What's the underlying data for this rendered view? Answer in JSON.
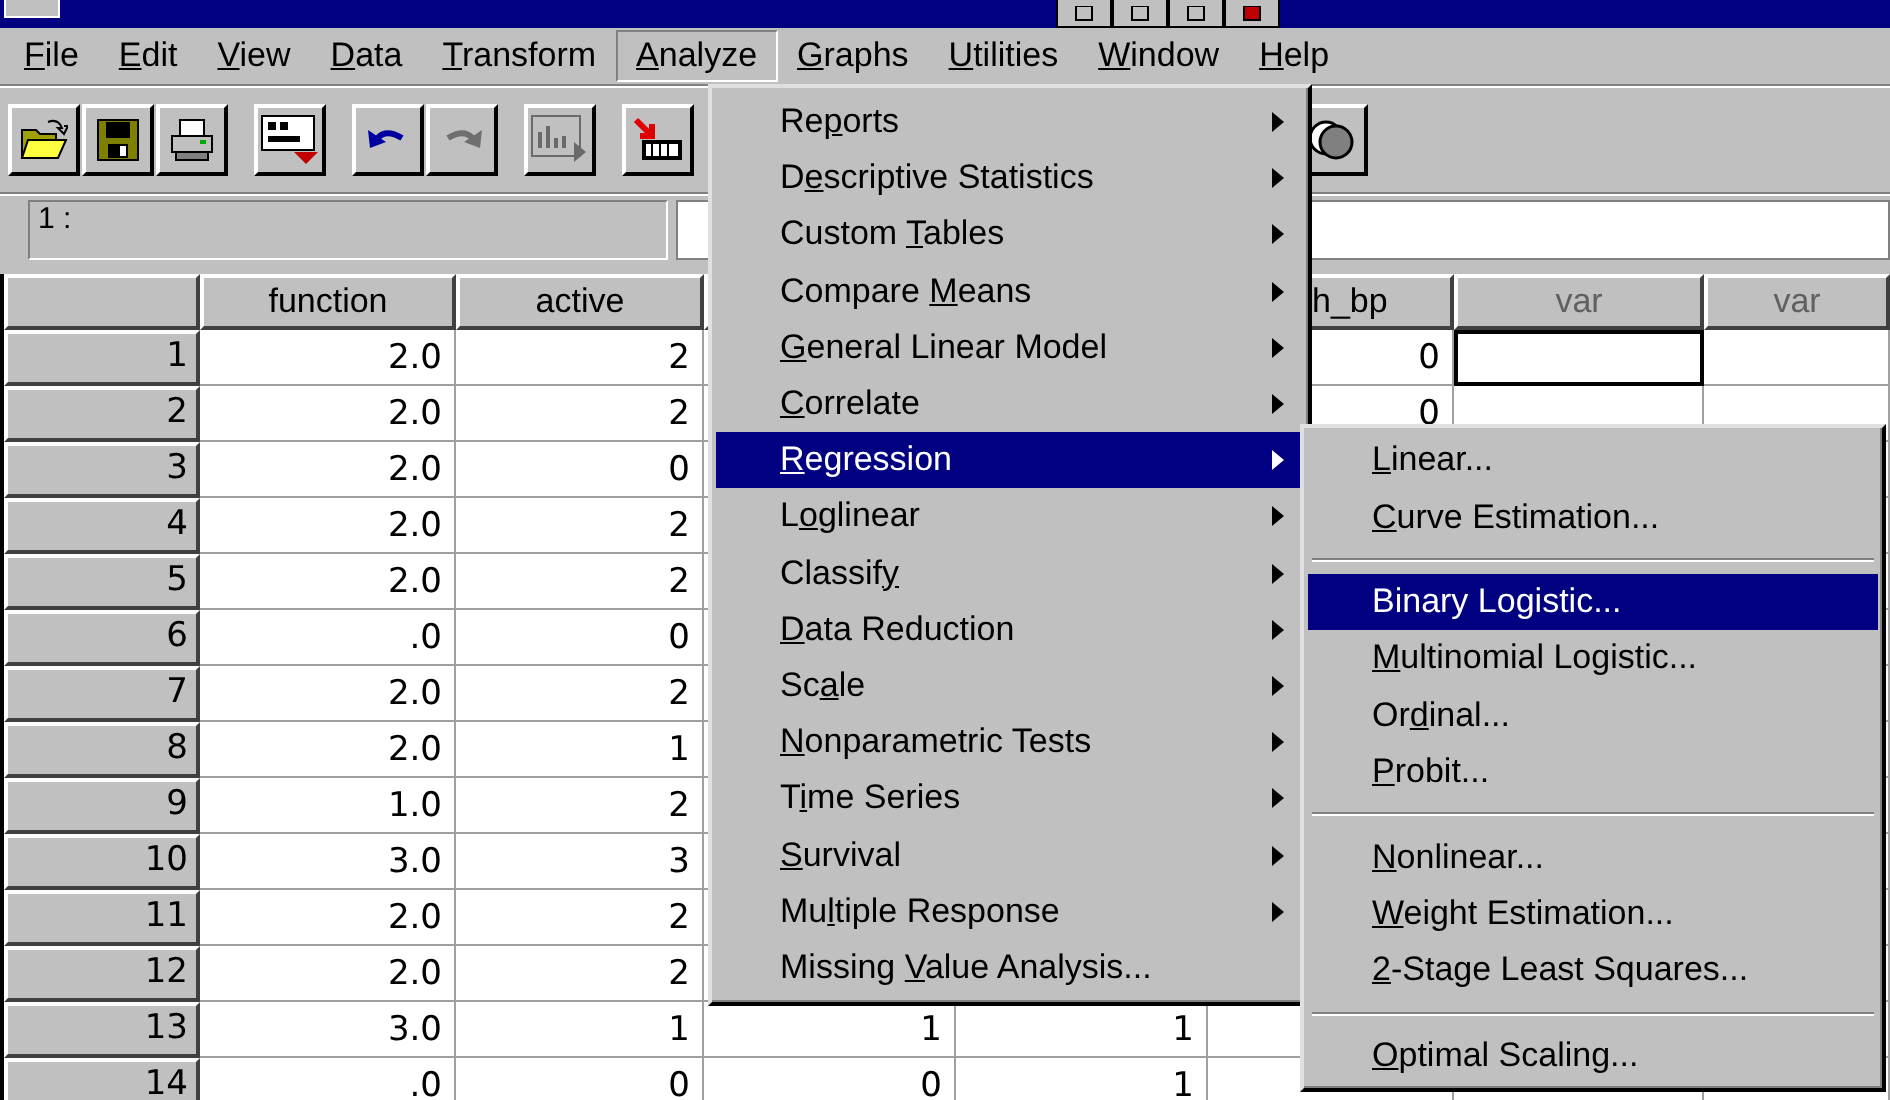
{
  "menubar": [
    {
      "key": "F",
      "after": "ile",
      "selected": false
    },
    {
      "key": "E",
      "after": "dit",
      "selected": false
    },
    {
      "key": "V",
      "after": "iew",
      "selected": false
    },
    {
      "key": "D",
      "after": "ata",
      "selected": false
    },
    {
      "key": "T",
      "after": "ransform",
      "selected": false
    },
    {
      "key": "A",
      "after": "nalyze",
      "selected": true
    },
    {
      "key": "G",
      "after": "raphs",
      "selected": false
    },
    {
      "key": "U",
      "after": "tilities",
      "selected": false
    },
    {
      "key": "W",
      "after": "indow",
      "selected": false
    },
    {
      "key": "H",
      "after": "elp",
      "selected": false
    }
  ],
  "toolbar": [
    {
      "kind": "open",
      "disabled": false
    },
    {
      "kind": "save",
      "disabled": false
    },
    {
      "kind": "print",
      "disabled": false
    },
    {
      "kind": "recall",
      "disabled": false
    },
    {
      "kind": "undo",
      "disabled": false
    },
    {
      "kind": "redo",
      "disabled": true
    },
    {
      "kind": "chart",
      "disabled": true
    },
    {
      "kind": "insert",
      "disabled": false
    }
  ],
  "toolbar_right": [
    {
      "kind": "circles",
      "disabled": false
    }
  ],
  "cell_editor": {
    "cell": "1 :"
  },
  "table": {
    "columns": [
      {
        "label": "function",
        "muted": false
      },
      {
        "label": "active",
        "muted": false
      },
      null,
      null,
      {
        "label": "h_bp",
        "muted": false,
        "cut": true
      },
      {
        "label": "var",
        "muted": true
      },
      {
        "label": "var",
        "muted": true
      }
    ],
    "rows": [
      {
        "number": "1",
        "cells": [
          {
            "value": "2.0",
            "selected": false
          },
          {
            "value": "2",
            "selected": false
          },
          null,
          null,
          {
            "value": "0",
            "selected": false
          },
          {
            "selected": true
          },
          {
            "selected": false
          }
        ]
      },
      {
        "number": "2",
        "cells": [
          {
            "value": "2.0",
            "selected": false
          },
          {
            "value": "2",
            "selected": false
          },
          null,
          null,
          {
            "value": "0",
            "selected": false
          },
          null,
          null
        ]
      },
      {
        "number": "3",
        "cells": [
          {
            "value": "2.0",
            "selected": false
          },
          {
            "value": "0",
            "selected": false
          },
          null,
          null,
          null,
          null,
          null
        ]
      },
      {
        "number": "4",
        "cells": [
          {
            "value": "2.0",
            "selected": false
          },
          {
            "value": "2",
            "selected": false
          },
          null,
          null,
          null,
          null,
          null
        ]
      },
      {
        "number": "5",
        "cells": [
          {
            "value": "2.0",
            "selected": false
          },
          {
            "value": "2",
            "selected": false
          },
          null,
          null,
          null,
          null,
          null
        ]
      },
      {
        "number": "6",
        "cells": [
          {
            "value": ".0",
            "selected": false
          },
          {
            "value": "0",
            "selected": false
          },
          null,
          null,
          null,
          null,
          null
        ]
      },
      {
        "number": "7",
        "cells": [
          {
            "value": "2.0",
            "selected": false
          },
          {
            "value": "2",
            "selected": false
          },
          null,
          null,
          null,
          null,
          null
        ]
      },
      {
        "number": "8",
        "cells": [
          {
            "value": "2.0",
            "selected": false
          },
          {
            "value": "1",
            "selected": false
          },
          null,
          null,
          null,
          null,
          null
        ]
      },
      {
        "number": "9",
        "cells": [
          {
            "value": "1.0",
            "selected": false
          },
          {
            "value": "2",
            "selected": false
          },
          null,
          null,
          null,
          null,
          null
        ]
      },
      {
        "number": "10",
        "cells": [
          {
            "value": "3.0",
            "selected": false
          },
          {
            "value": "3",
            "selected": false
          },
          null,
          null,
          null,
          null,
          null
        ]
      },
      {
        "number": "11",
        "cells": [
          {
            "value": "2.0",
            "selected": false
          },
          {
            "value": "2",
            "selected": false
          },
          null,
          null,
          null,
          null,
          null
        ]
      },
      {
        "number": "12",
        "cells": [
          {
            "value": "2.0",
            "selected": false
          },
          {
            "value": "2",
            "selected": false
          },
          null,
          null,
          null,
          null,
          null
        ]
      },
      {
        "number": "13",
        "cells": [
          {
            "value": "3.0",
            "selected": false
          },
          {
            "value": "1",
            "selected": false
          },
          {
            "value": "1",
            "selected": false
          },
          {
            "value": "1",
            "selected": false
          },
          null,
          null,
          null
        ]
      },
      {
        "number": "14",
        "cells": [
          {
            "value": ".0",
            "selected": false
          },
          {
            "value": "0",
            "selected": false
          },
          {
            "value": "0",
            "selected": false
          },
          {
            "value": "1",
            "selected": false
          },
          null,
          null,
          null
        ]
      }
    ]
  },
  "analyze_menu": [
    {
      "kind": "item",
      "before": "Re",
      "key": "p",
      "after": "orts",
      "submenu": true,
      "selected": false
    },
    {
      "kind": "item",
      "before": "D",
      "key": "e",
      "after": "scriptive Statistics",
      "submenu": true,
      "selected": false
    },
    {
      "kind": "item",
      "before": "Custom ",
      "key": "T",
      "after": "ables",
      "submenu": true,
      "selected": false
    },
    {
      "kind": "item",
      "before": "Compare ",
      "key": "M",
      "after": "eans",
      "submenu": true,
      "selected": false
    },
    {
      "kind": "item",
      "key": "G",
      "after": "eneral Linear Model",
      "submenu": true,
      "selected": false
    },
    {
      "kind": "item",
      "key": "C",
      "after": "orrelate",
      "submenu": true,
      "selected": false
    },
    {
      "kind": "item",
      "key": "R",
      "after": "egression",
      "submenu": true,
      "selected": true
    },
    {
      "kind": "item",
      "before": "L",
      "key": "o",
      "after": "glinear",
      "submenu": true,
      "selected": false
    },
    {
      "kind": "item",
      "before": "Classif",
      "key": "y",
      "submenu": true,
      "selected": false
    },
    {
      "kind": "item",
      "key": "D",
      "after": "ata Reduction",
      "submenu": true,
      "selected": false
    },
    {
      "kind": "item",
      "before": "Sc",
      "key": "a",
      "after": "le",
      "submenu": true,
      "selected": false
    },
    {
      "kind": "item",
      "key": "N",
      "after": "onparametric Tests",
      "submenu": true,
      "selected": false
    },
    {
      "kind": "item",
      "before": "T",
      "key": "i",
      "after": "me Series",
      "submenu": true,
      "selected": false
    },
    {
      "kind": "item",
      "key": "S",
      "after": "urvival",
      "submenu": true,
      "selected": false
    },
    {
      "kind": "item",
      "before": "Mu",
      "key": "l",
      "after": "tiple Response",
      "submenu": true,
      "selected": false
    },
    {
      "kind": "item",
      "before": "Missing ",
      "key": "V",
      "after": "alue Analysis...",
      "submenu": false,
      "selected": false
    }
  ],
  "regression_menu": [
    {
      "kind": "item",
      "key": "L",
      "after": "inear...",
      "selected": false
    },
    {
      "kind": "item",
      "key": "C",
      "after": "urve Estimation...",
      "selected": false
    },
    {
      "kind": "separator"
    },
    {
      "kind": "item",
      "before": "Binary Lo",
      "key": "g",
      "after": "istic...",
      "selected": true
    },
    {
      "kind": "item",
      "key": "M",
      "after": "ultinomial Logistic...",
      "selected": false
    },
    {
      "kind": "item",
      "before": "Or",
      "key": "d",
      "after": "inal...",
      "selected": false
    },
    {
      "kind": "item",
      "key": "P",
      "after": "robit...",
      "selected": false
    },
    {
      "kind": "separator"
    },
    {
      "kind": "item",
      "key": "N",
      "after": "onlinear...",
      "selected": false
    },
    {
      "kind": "item",
      "key": "W",
      "after": "eight Estimation...",
      "selected": false
    },
    {
      "kind": "item",
      "key": "2",
      "after": "-Stage Least Squares...",
      "selected": false
    },
    {
      "kind": "separator"
    },
    {
      "kind": "item",
      "key": "O",
      "after": "ptimal Scaling...",
      "selected": false
    }
  ]
}
